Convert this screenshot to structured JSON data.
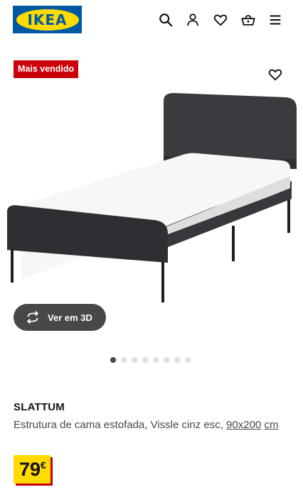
{
  "header": {
    "logo_text": "IKEA",
    "icons": [
      "search-icon",
      "user-icon",
      "heart-icon",
      "basket-icon",
      "menu-icon"
    ],
    "brand_blue": "#0058a3",
    "brand_yellow": "#ffdb00"
  },
  "product": {
    "badge": "Mais vendido",
    "badge_color": "#cc0008",
    "view3d_label": "Ver em 3D",
    "carousel": {
      "total": 8,
      "active": 1
    },
    "name": "SLATTUM",
    "description": "Estrutura de cama estofada, Vissle cinz esc,",
    "size_link": "90x200",
    "size_unit": "cm",
    "price_integer": "79",
    "price_currency": "€"
  }
}
